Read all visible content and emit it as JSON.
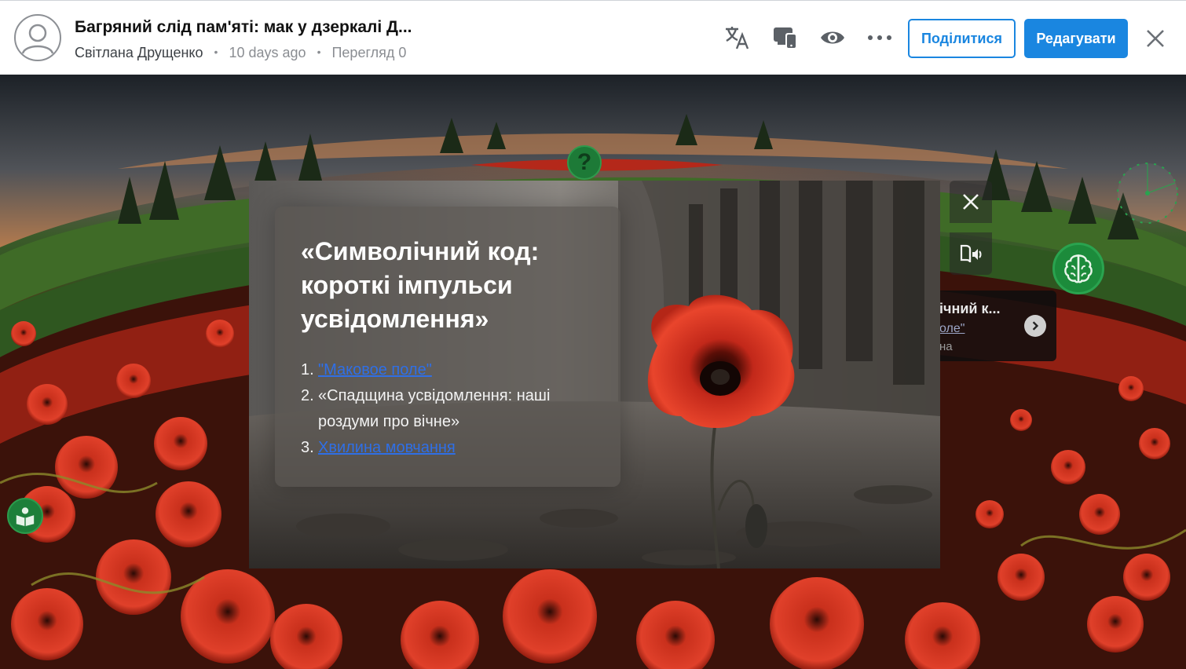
{
  "header": {
    "title": "Багряний слід пам'яті: мак у дзеркалі Д...",
    "author": "Світлана Друщенко",
    "age": "10 days ago",
    "views": "Перегляд 0",
    "share_label": "Поділитися",
    "edit_label": "Редагувати",
    "icons": [
      "translate-icon",
      "devices-icon",
      "eye-icon",
      "more-icon",
      "close-icon"
    ]
  },
  "modal": {
    "title": "«Символічний код: короткі імпульси усвідомлення»",
    "items": [
      {
        "num": "1.",
        "text": "\"Маковое поле\"",
        "link": true
      },
      {
        "num": "2.",
        "text": "«Спадщина усвідомлення: наші роздуми про вічне»",
        "link": false
      },
      {
        "num": "3.",
        "text": "Хвилина мовчання",
        "link": true
      }
    ]
  },
  "peek_card": {
    "title": "ічний к...",
    "link": "оле\"",
    "sub": "на"
  },
  "hotspots": {
    "question_symbol": "?",
    "icons": [
      "question-icon",
      "brain-icon",
      "book-reader-icon",
      "compass-icon"
    ]
  },
  "colors": {
    "accent": "#1a86e0",
    "hotspot_green": "#1d7f3a",
    "link": "#2f6fe6"
  }
}
